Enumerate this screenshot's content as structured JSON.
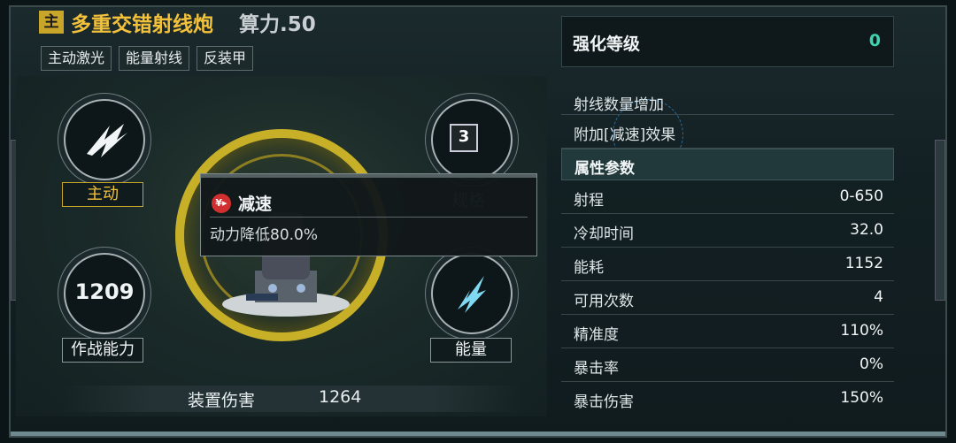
{
  "header": {
    "badge": "主",
    "title": "多重交错射线炮",
    "power": "算力.50",
    "tags": [
      "主动激光",
      "能量射线",
      "反装甲"
    ]
  },
  "nodes": {
    "top_left_label": "主动",
    "top_right_value": "3",
    "top_right_label": "规格",
    "bottom_left_value": "1209",
    "bottom_left_label": "作战能力",
    "bottom_right_label": "能量"
  },
  "tooltip": {
    "icon_text": "¥▸",
    "title": "减速",
    "description": "动力降低80.0%"
  },
  "damage": {
    "label": "装置伤害",
    "value": "1264"
  },
  "enhance": {
    "label": "强化等级",
    "value": "0"
  },
  "effects": [
    "射线数量增加",
    "附加[减速]效果"
  ],
  "attributes": {
    "section_title": "属性参数",
    "rows": [
      {
        "k": "射程",
        "v": "0-650"
      },
      {
        "k": "冷却时间",
        "v": "32.0"
      },
      {
        "k": "能耗",
        "v": "1152"
      },
      {
        "k": "可用次数",
        "v": "4"
      },
      {
        "k": "精准度",
        "v": "110%"
      },
      {
        "k": "暴击率",
        "v": "0%"
      },
      {
        "k": "暴击伤害",
        "v": "150%"
      }
    ]
  },
  "colors": {
    "gold": "#f3c23a",
    "teal": "#3fd3b0",
    "ring": "#c7b028"
  }
}
